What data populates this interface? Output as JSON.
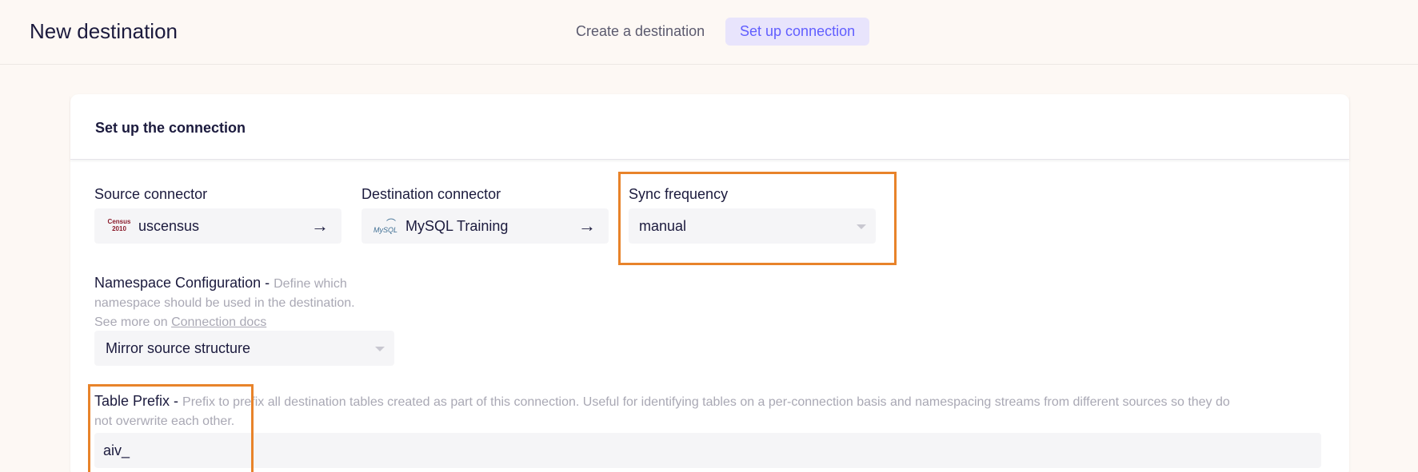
{
  "header": {
    "title": "New destination",
    "steps": [
      {
        "label": "Create a destination"
      },
      {
        "label": "Set up connection"
      }
    ]
  },
  "card": {
    "title": "Set up the connection"
  },
  "source": {
    "label": "Source connector",
    "value": "uscensus",
    "logo_text": "Census 2010"
  },
  "destination": {
    "label": "Destination connector",
    "value": "MySQL Training",
    "logo_text": "MySQL"
  },
  "sync": {
    "label": "Sync frequency",
    "value": "manual"
  },
  "namespace": {
    "label": "Namespace Configuration - ",
    "hint_line1": "Define which",
    "hint_line2": "namespace should be used in the destination.",
    "hint_line3": "See more on ",
    "link": "Connection docs",
    "value": "Mirror source structure"
  },
  "prefix": {
    "label": "Table Prefix - ",
    "hint_line1": "Prefix to prefix all destination tables created as part of this connection. Useful for identifying tables on a per-connection basis and namespacing streams from different sources so they do",
    "hint_line2": "not overwrite each other.",
    "value": "aiv_"
  },
  "colors": {
    "accent": "#615eff",
    "highlight": "#e8832a",
    "background": "#fdf8f4"
  }
}
